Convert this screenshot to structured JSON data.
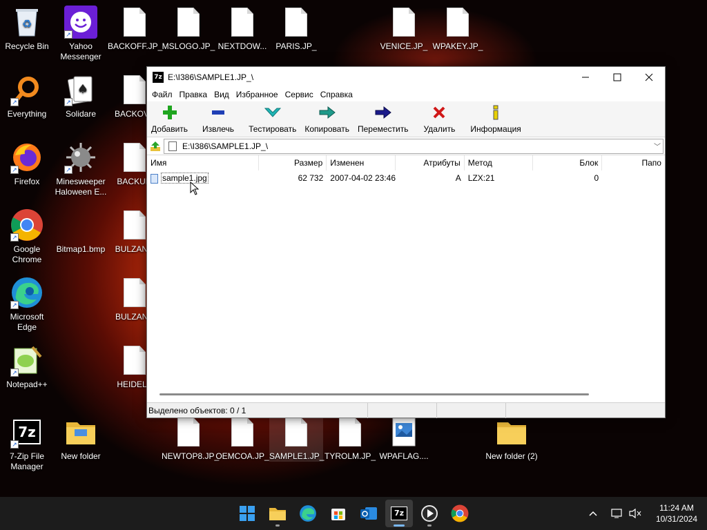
{
  "desktop": {
    "icons": [
      {
        "label": "Recycle Bin",
        "icon": "recycle-bin-icon"
      },
      {
        "label": "Yahoo Messenger",
        "icon": "yahoo-messenger-icon"
      },
      {
        "label": "BACKOFF.JP_",
        "icon": "file-icon"
      },
      {
        "label": "MSLOGO.JP_",
        "icon": "file-icon"
      },
      {
        "label": "NEXTDOW...",
        "icon": "file-icon"
      },
      {
        "label": "PARIS.JP_",
        "icon": "file-icon"
      },
      {
        "label": "VENICE.JP_",
        "icon": "file-icon"
      },
      {
        "label": "WPAKEY.JP_",
        "icon": "file-icon"
      },
      {
        "label": "Everything",
        "icon": "everything-search-icon"
      },
      {
        "label": "Solidare",
        "icon": "solitaire-cards-icon"
      },
      {
        "label": "BACKOVE",
        "icon": "file-icon"
      },
      {
        "label": "Firefox",
        "icon": "firefox-icon"
      },
      {
        "label": "Minesweeper Haloween E...",
        "icon": "minesweeper-mine-icon"
      },
      {
        "label": "BACKUP.",
        "icon": "file-icon"
      },
      {
        "label": "Google Chrome",
        "icon": "chrome-icon"
      },
      {
        "label": "Bitmap1.bmp",
        "icon": "bitmap-icon"
      },
      {
        "label": "BULZANO",
        "icon": "file-icon"
      },
      {
        "label": "Microsoft Edge",
        "icon": "edge-icon"
      },
      {
        "label": "BULZANC",
        "icon": "file-icon"
      },
      {
        "label": "Notepad++",
        "icon": "notepad-plus-plus-icon"
      },
      {
        "label": "HEIDELB",
        "icon": "file-icon"
      },
      {
        "label": "7-Zip File Manager",
        "icon": "7zip-icon"
      },
      {
        "label": "New folder",
        "icon": "folder-icon"
      },
      {
        "label": "NEWTOP8.JP_",
        "icon": "file-icon"
      },
      {
        "label": "OEMCOA.JP_",
        "icon": "file-icon"
      },
      {
        "label": "SAMPLE1.JP_",
        "icon": "file-icon"
      },
      {
        "label": "TYROLM.JP_",
        "icon": "file-icon"
      },
      {
        "label": "WPAFLAG....",
        "icon": "image-file-icon"
      },
      {
        "label": "New folder (2)",
        "icon": "folder-icon"
      }
    ]
  },
  "window": {
    "title": "E:\\I386\\SAMPLE1.JP_\\",
    "logo": "7z",
    "menu": [
      "Файл",
      "Правка",
      "Вид",
      "Избранное",
      "Сервис",
      "Справка"
    ],
    "toolbar": [
      {
        "label": "Добавить",
        "icon": "add-plus-icon",
        "color": "#1fa51f"
      },
      {
        "label": "Извлечь",
        "icon": "extract-minus-icon",
        "color": "#1f3fb5"
      },
      {
        "label": "Тестировать",
        "icon": "test-check-icon",
        "color": "#1fb5b5"
      },
      {
        "label": "Копировать",
        "icon": "copy-arrow-icon",
        "color": "#1f9a8a"
      },
      {
        "label": "Переместить",
        "icon": "move-arrow-icon",
        "color": "#1a1a8a"
      },
      {
        "label": "Удалить",
        "icon": "delete-x-icon",
        "color": "#d01818"
      },
      {
        "label": "Информация",
        "icon": "info-icon",
        "color": "#c8b400"
      }
    ],
    "address": "E:\\I386\\SAMPLE1.JP_\\",
    "columns": [
      "Имя",
      "Размер",
      "Изменен",
      "Атрибуты",
      "Метод",
      "Блок",
      "Папо"
    ],
    "rows": [
      {
        "name": "sample1.jpg",
        "size": "62 732",
        "modified": "2007-04-02 23:46",
        "attributes": "A",
        "method": "LZX:21",
        "block": "0"
      }
    ],
    "status": "Выделено объектов: 0 / 1"
  },
  "taskbar": {
    "clock_time": "11:24 AM",
    "clock_date": "10/31/2024",
    "apps": [
      "start-icon",
      "file-explorer-icon",
      "edge-icon",
      "store-icon",
      "outlook-icon",
      "7zip-icon",
      "media-player-icon",
      "chrome-icon"
    ]
  }
}
